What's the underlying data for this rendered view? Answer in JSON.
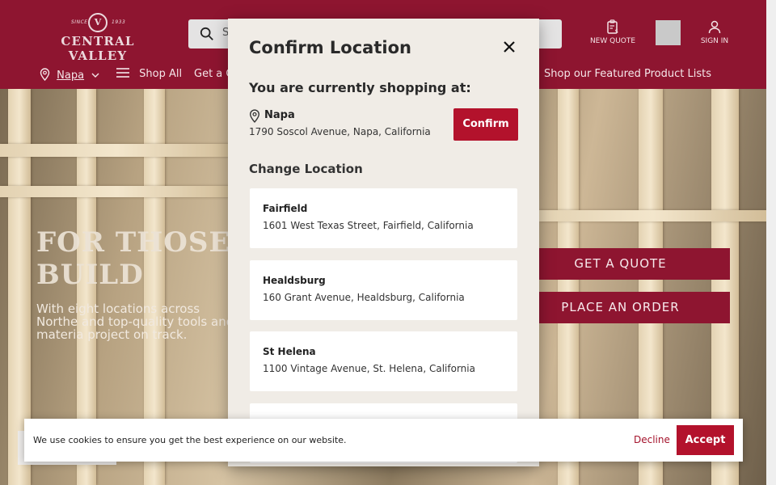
{
  "header": {
    "logo": {
      "since_left": "SINCE",
      "since_right": "1933",
      "emblem": "V",
      "wordmark": "CENTRAL VALLEY"
    },
    "search": {
      "placeholder": "S",
      "icon": "search-icon"
    },
    "new_quote_label": "NEW QUOTE",
    "sign_in_label": "SIGN IN"
  },
  "nav": {
    "location": "Napa",
    "shop_all": "Shop All",
    "get_quote": "Get a Q",
    "featured": "Shop our Featured Product Lists"
  },
  "hero": {
    "title_line1": "FOR THOSE WI",
    "title_line2": "BUILD",
    "text": "With eight locations across Northe and top-quality tools and materia project on track.",
    "cta_quote": "GET A QUOTE",
    "cta_order": "PLACE AN ORDER"
  },
  "modal": {
    "title": "Confirm Location",
    "current_heading": "You are currently shopping at:",
    "current": {
      "name": "Napa",
      "address": "1790 Soscol Avenue, Napa, California"
    },
    "confirm_label": "Confirm",
    "change_heading": "Change Location",
    "locations": [
      {
        "name": "Fairfield",
        "address": "1601 West Texas Street, Fairfield, California"
      },
      {
        "name": "Healdsburg",
        "address": "160 Grant Avenue, Healdsburg, California"
      },
      {
        "name": "St Helena",
        "address": "1100 Vintage Avenue, St. Helena, California"
      },
      {
        "name": "",
        "address": ""
      }
    ]
  },
  "cookie": {
    "message": "We use cookies to ensure you get the best experience on our website.",
    "decline": "Decline",
    "accept": "Accept"
  },
  "colors": {
    "brand": "#8e1530",
    "button": "#b3122c",
    "modal_bg": "#f0ece6"
  }
}
